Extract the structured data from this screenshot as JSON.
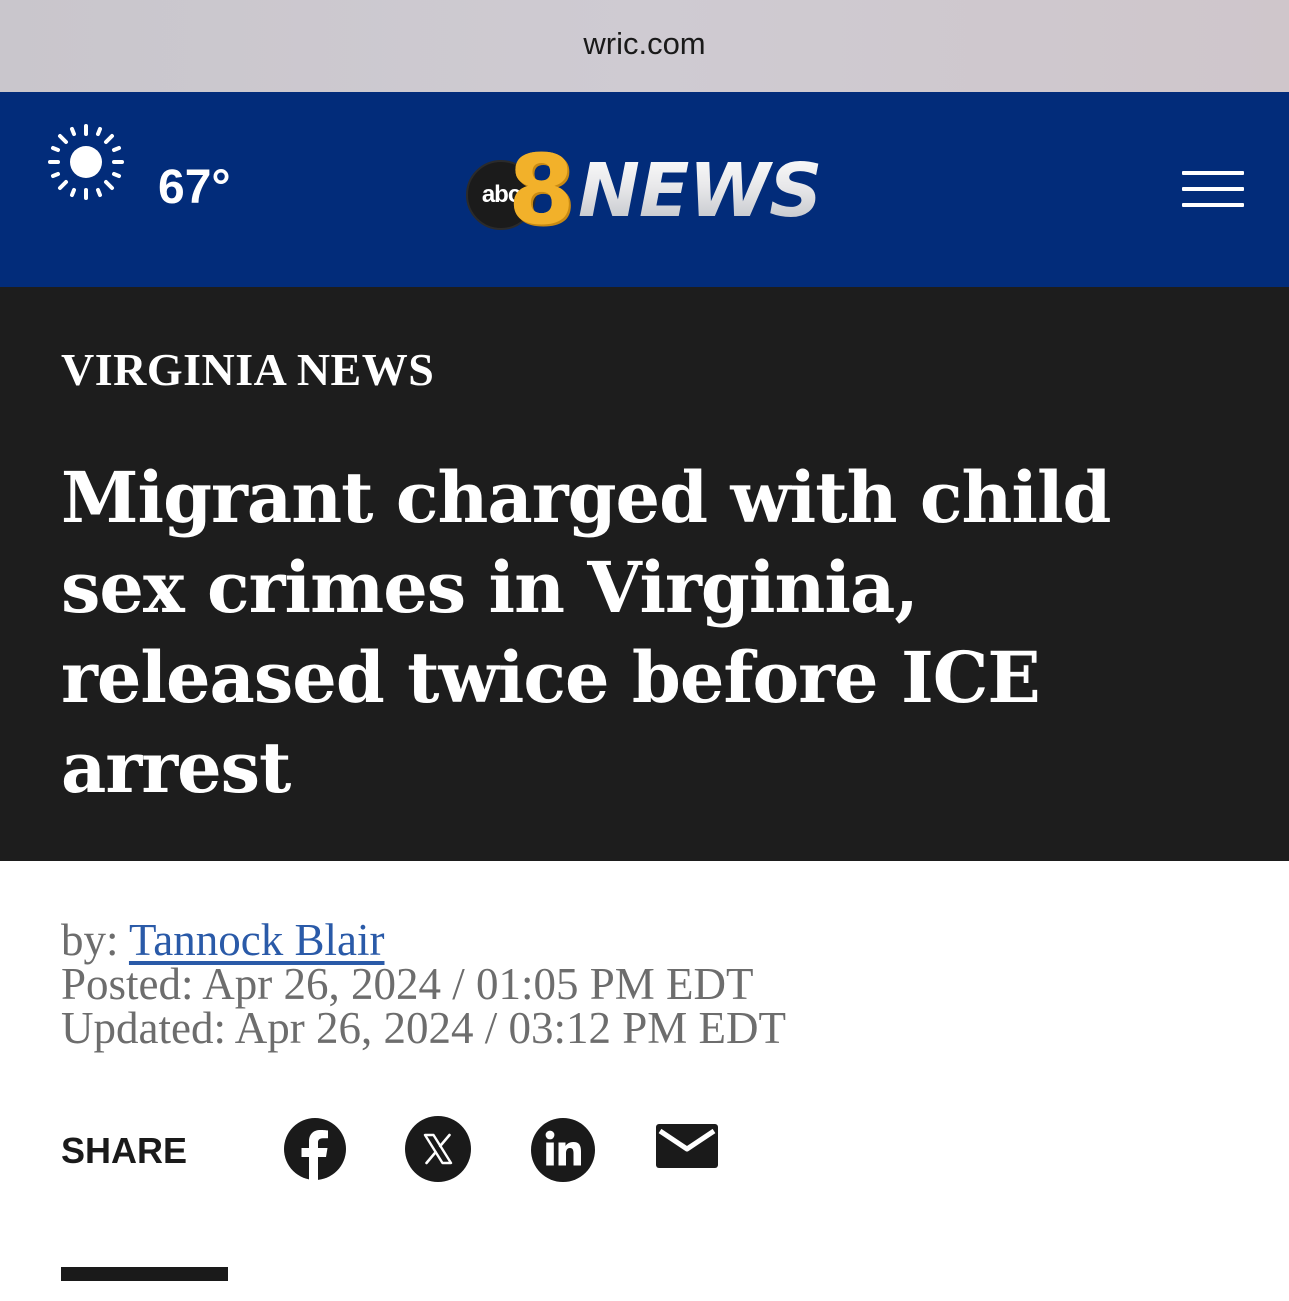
{
  "browser": {
    "url": "wric.com"
  },
  "header": {
    "weather_icon": "sun-icon",
    "temperature": "67°",
    "logo": {
      "badge": "abc",
      "number": "8",
      "word": "NEWS"
    },
    "menu_icon": "hamburger-menu-icon",
    "background_color": "#022c7a"
  },
  "article": {
    "category": "VIRGINIA NEWS",
    "headline": "Migrant charged with child sex crimes in Virginia, released twice before ICE arrest",
    "byline_prefix": "by:",
    "author": "Tannock Blair",
    "posted": "Posted: Apr 26, 2024 / 01:05 PM EDT",
    "updated": "Updated: Apr 26, 2024 / 03:12 PM EDT"
  },
  "share": {
    "label": "SHARE",
    "icons": [
      "facebook-icon",
      "x-icon",
      "linkedin-icon",
      "email-icon"
    ]
  },
  "colors": {
    "hero_bg": "#1d1d1d",
    "link": "#2a5aa8",
    "meta_text": "#6d6d6d"
  }
}
